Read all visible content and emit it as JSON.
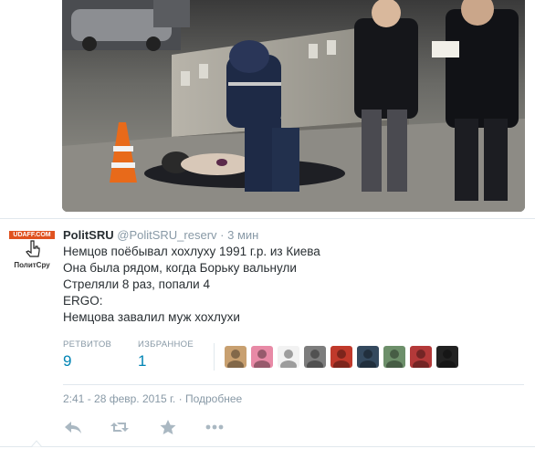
{
  "tweet": {
    "display_name": "PolitSRU",
    "handle": "@PolitSRU_reserv",
    "separator": "·",
    "time_ago": "3 мин",
    "lines": [
      "Немцов поёбывал хохлуху 1991 г.р. из Киева",
      "Она была рядом, когда Борьку вальнули",
      "Стреляли 8 раз, попали 4",
      "ERGO:",
      "Немцова завалил муж хохлухи"
    ],
    "avatar": {
      "banner_text": "UDAFF.COM",
      "caption": "ПолитСру",
      "icon": "pointing-hand-icon"
    }
  },
  "stats": {
    "retweets_label": "РЕТВИТОВ",
    "retweets_count": "9",
    "favorites_label": "ИЗБРАННОЕ",
    "favorites_count": "1"
  },
  "favoriters": [
    {
      "icon": "user-avatar-icon",
      "color": "#c8a070"
    },
    {
      "icon": "user-avatar-icon",
      "color": "#e88aa6"
    },
    {
      "icon": "user-avatar-icon",
      "color": "#f2f2f2"
    },
    {
      "icon": "user-avatar-icon",
      "color": "#7d7d7d"
    },
    {
      "icon": "user-avatar-icon",
      "color": "#c0392b"
    },
    {
      "icon": "user-avatar-icon",
      "color": "#34495e"
    },
    {
      "icon": "user-avatar-icon",
      "color": "#6d8f6a"
    },
    {
      "icon": "user-avatar-icon",
      "color": "#b33939"
    },
    {
      "icon": "user-avatar-icon",
      "color": "#222222"
    }
  ],
  "timestamp": {
    "datetime": "2:41 - 28 февр. 2015 г.",
    "separator": "·",
    "details_link": "Подробнее"
  },
  "actions": {
    "reply_icon": "reply-icon",
    "retweet_icon": "retweet-icon",
    "favorite_icon": "star-icon",
    "more_icon": "more-icon"
  },
  "colors": {
    "link_blue": "#0084b4",
    "muted": "#8899a6",
    "text": "#292f33",
    "border": "#e1e8ed",
    "action_gray": "#aab8c2",
    "udaff_orange": "#e0521f"
  }
}
